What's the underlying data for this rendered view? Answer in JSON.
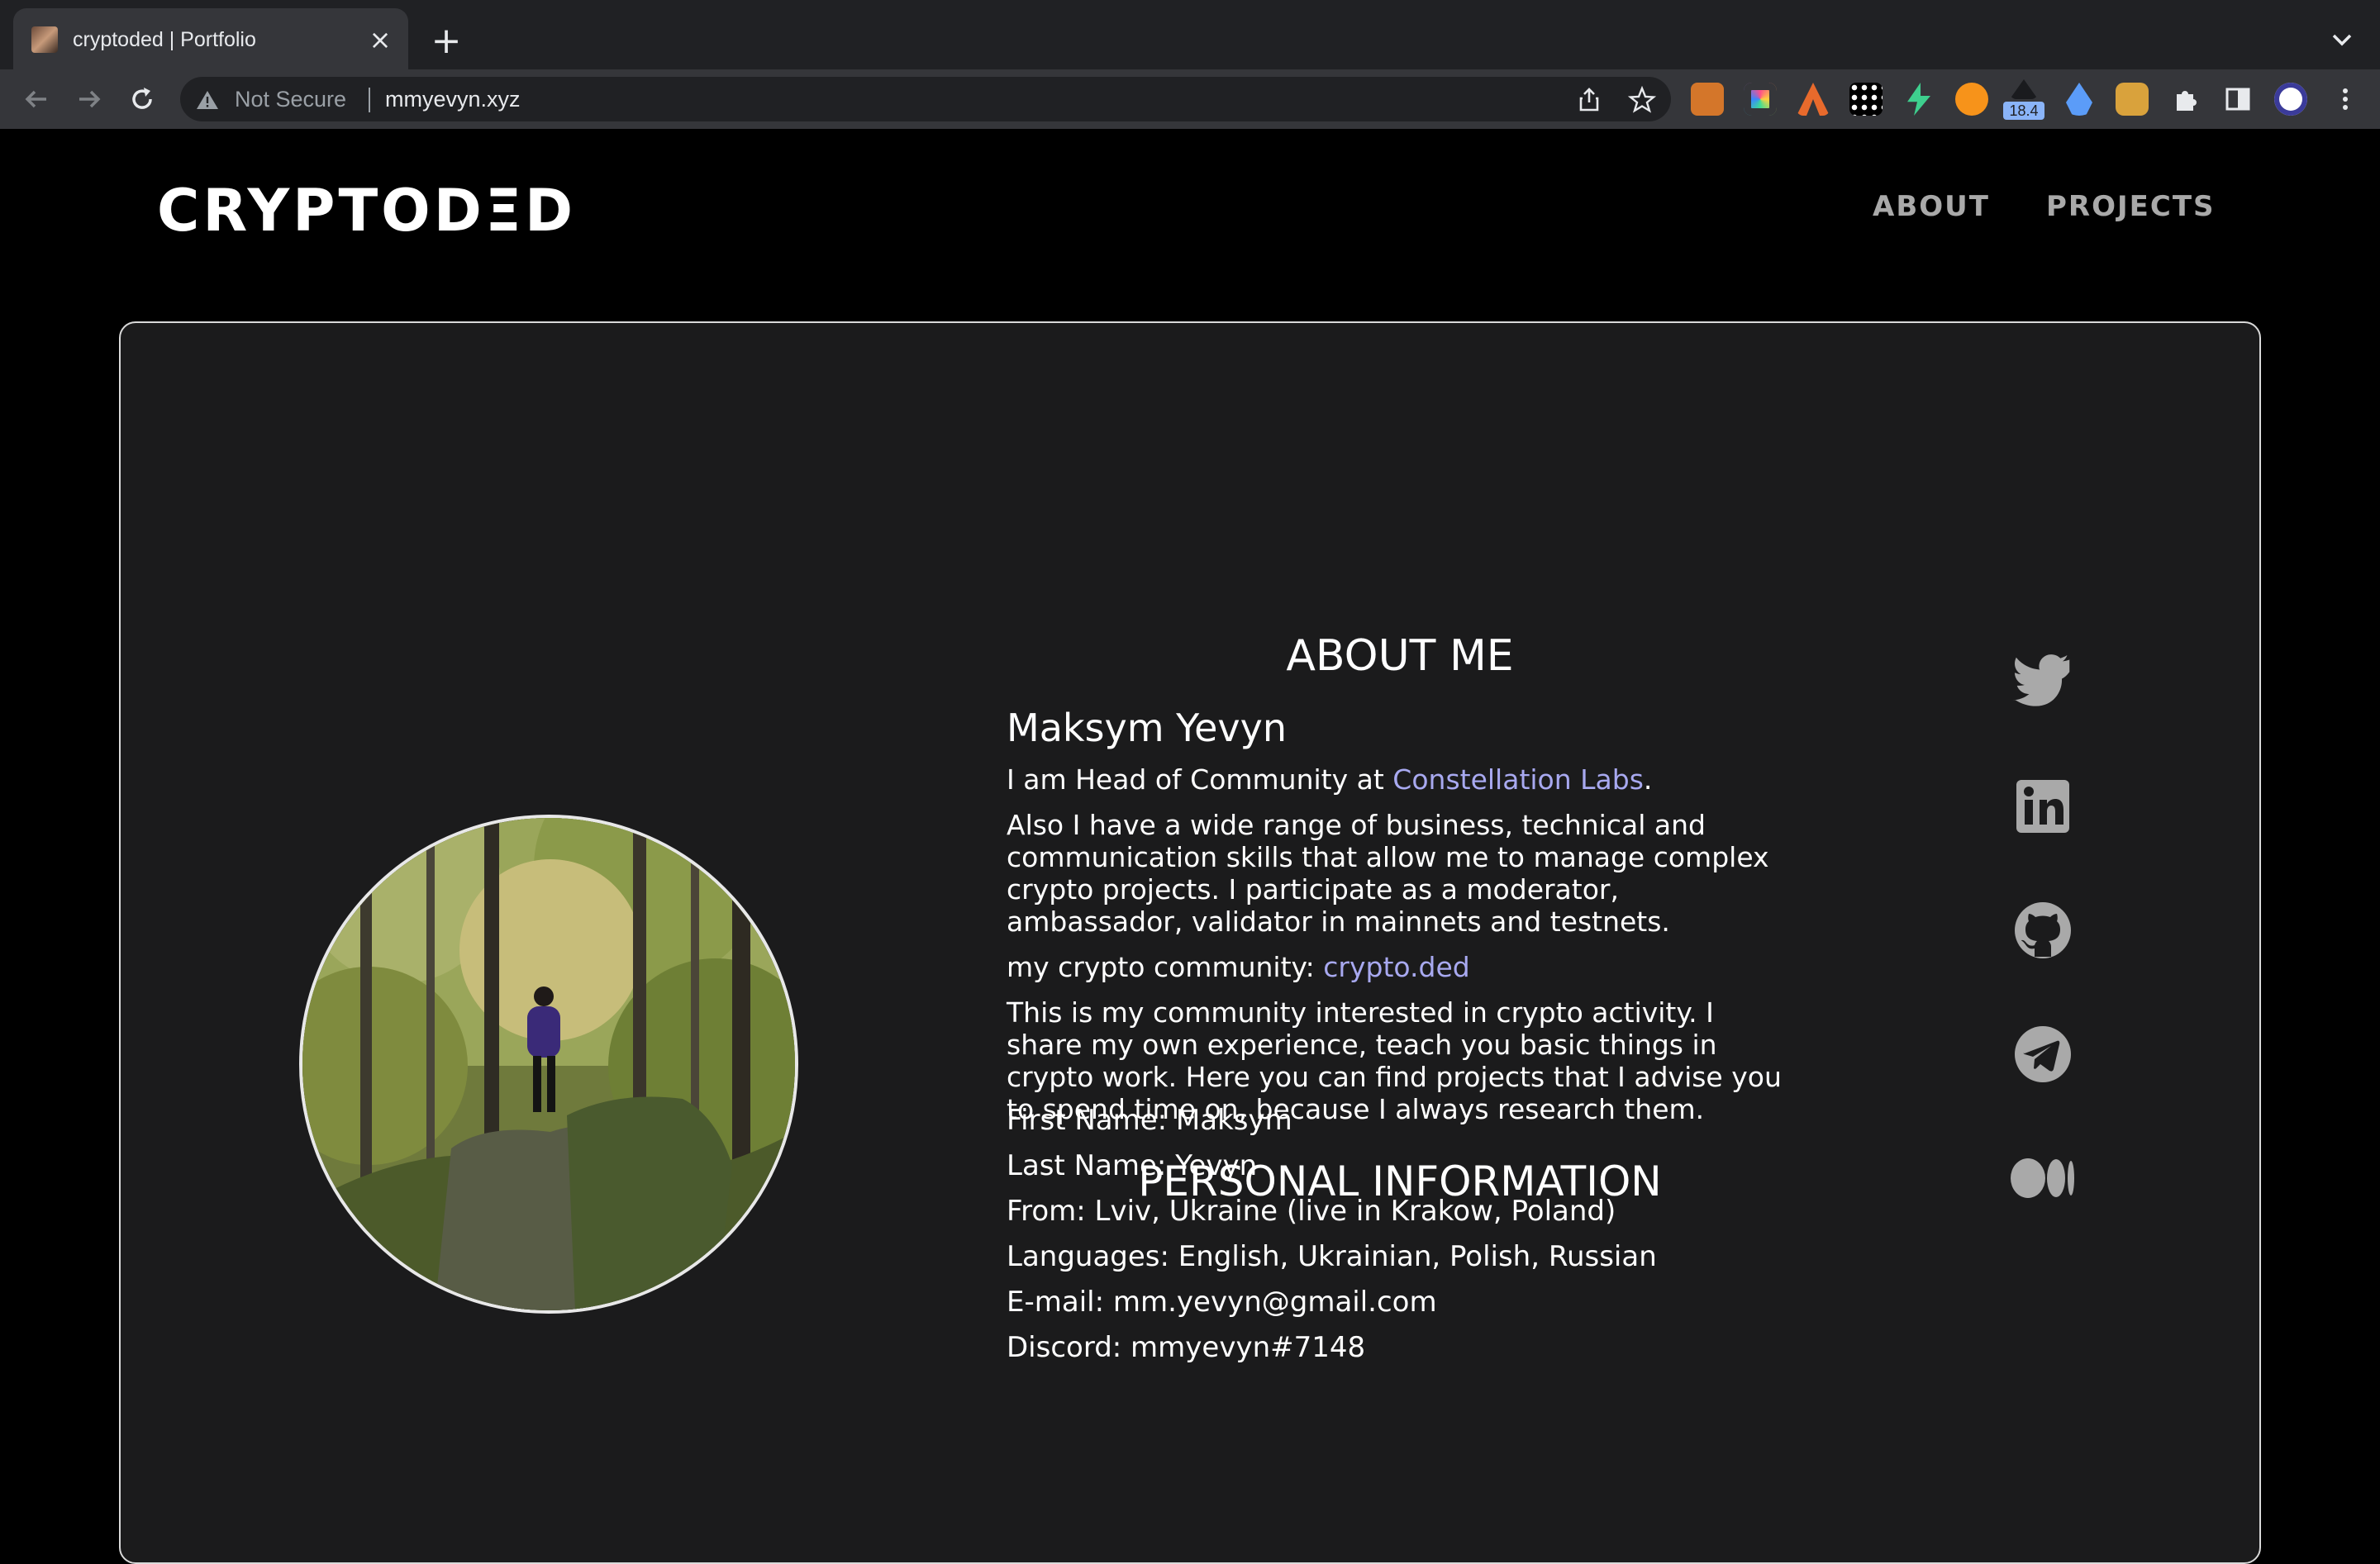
{
  "browser": {
    "tab_title": "cryptoded | Portfolio",
    "close_glyph": "×",
    "new_tab_glyph": "+",
    "security_label": "Not Secure",
    "url": "mmyevyn.xyz",
    "extension_badge": "18.4",
    "extensions": [
      "fox-extension-icon",
      "ring-extension-icon",
      "arrow-extension-icon",
      "grid-extension-icon",
      "bolt-extension-icon",
      "coin-extension-icon",
      "badge-extension-icon",
      "drop-extension-icon",
      "lion-extension-icon",
      "puzzle-icon",
      "side-panel-icon",
      "profile-avatar"
    ]
  },
  "site": {
    "logo": "CRYPTODΞD",
    "nav": [
      "ABOUT",
      "PROJECTS"
    ]
  },
  "about": {
    "heading": "ABOUT ME",
    "name": "Maksym Yevyn",
    "intro_prefix": "I am Head of Community at ",
    "intro_link": "Constellation Labs",
    "intro_suffix": ".",
    "skills_lines": [
      "Also I have a wide range of business, technical and",
      "communication skills that allow me to manage complex",
      "crypto projects. I participate as a moderator,",
      "ambassador, validator in mainnets and testnets."
    ],
    "community_prefix": "my crypto community: ",
    "community_link": "crypto.ded",
    "community_lines": [
      "This is my community interested in crypto activity. I",
      "share my own experience, teach you basic things in",
      "crypto work. Here you can find projects that I advise you",
      "to spend time on, because I always research them."
    ]
  },
  "personal": {
    "heading": "PERSONAL INFORMATION",
    "rows": [
      "First Name: Maksym",
      "Last Name: Yevyn",
      "From: Lviv, Ukraine (live in Krakow, Poland)",
      "Languages: English, Ukrainian, Polish, Russian",
      "E-mail: mm.yevyn@gmail.com",
      "Discord: mmyevyn#7148"
    ]
  },
  "social": [
    "twitter-icon",
    "linkedin-icon",
    "github-icon",
    "telegram-icon",
    "medium-icon"
  ],
  "colors": {
    "link": "#a8a9f0",
    "card": "#1b1b1c",
    "icon": "#a9a9a9"
  }
}
